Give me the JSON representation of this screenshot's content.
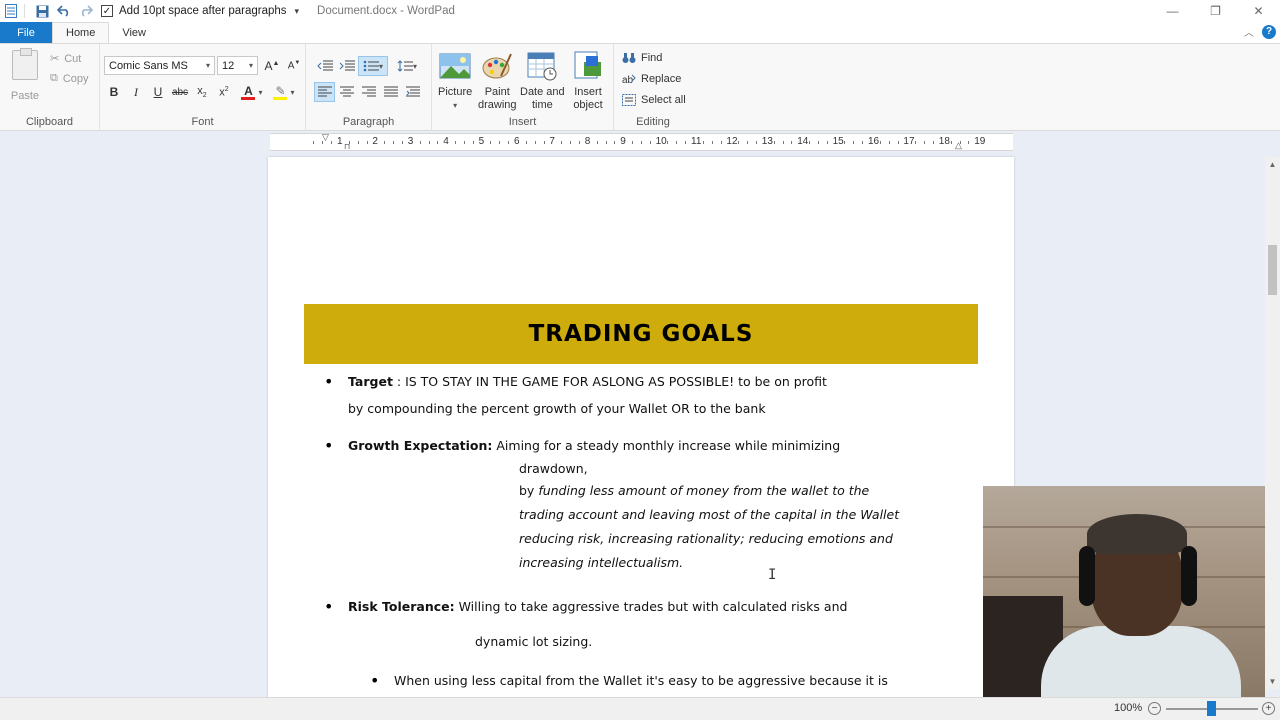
{
  "titlebar": {
    "qa_option": "Add 10pt space after paragraphs",
    "title": "Document.docx - WordPad"
  },
  "tabs": {
    "file": "File",
    "home": "Home",
    "view": "View"
  },
  "clipboard": {
    "paste": "Paste",
    "cut": "Cut",
    "copy": "Copy",
    "label": "Clipboard"
  },
  "font": {
    "family": "Comic Sans MS",
    "size": "12",
    "label": "Font",
    "color_accent": "#e02020",
    "highlight_accent": "#fff200"
  },
  "paragraph": {
    "label": "Paragraph"
  },
  "insert": {
    "picture": "Picture",
    "paint_1": "Paint",
    "paint_2": "drawing",
    "date_1": "Date and",
    "date_2": "time",
    "object_1": "Insert",
    "object_2": "object",
    "label": "Insert"
  },
  "editing": {
    "find": "Find",
    "replace": "Replace",
    "select_all": "Select all",
    "label": "Editing"
  },
  "ruler": {
    "numbers": [
      "1",
      "2",
      "3",
      "4",
      "5",
      "6",
      "7",
      "8",
      "9",
      "10",
      "11",
      "12",
      "13",
      "14",
      "15",
      "16",
      "17",
      "18",
      "19"
    ]
  },
  "document": {
    "banner": "TRADING GOALS",
    "target_label": "Target",
    "target_text_1": " :  IS TO STAY IN THE GAME FOR ASLONG AS POSSIBLE! to be on profit",
    "target_text_2": "by compounding the percent growth of your Wallet OR to the bank",
    "growth_label": "Growth Expectation:",
    "growth_text_1": " Aiming for a steady monthly increase while minimizing",
    "growth_text_2": "drawdown,",
    "growth_text_3_pre": "by ",
    "growth_text_3": "funding less amount of money from the wallet to the",
    "growth_text_4": "trading account and leaving most of the capital in the Wallet",
    "growth_text_5": "reducing risk, increasing rationality; reducing emotions and",
    "growth_text_6": "increasing intellectualism.",
    "risk_label": "Risk Tolerance:",
    "risk_text_1": " Willing to take aggressive trades but with calculated risks and",
    "risk_text_2": "dynamic lot sizing.",
    "sub_bullet": "When using less capital from the Wallet it's easy to be aggressive because it is"
  },
  "statusbar": {
    "zoom": "100%",
    "zoom_level_percent": 100
  },
  "colors": {
    "file_tab": "#1979ca",
    "banner": "#cdac0b",
    "workspace": "#e8edf6"
  }
}
